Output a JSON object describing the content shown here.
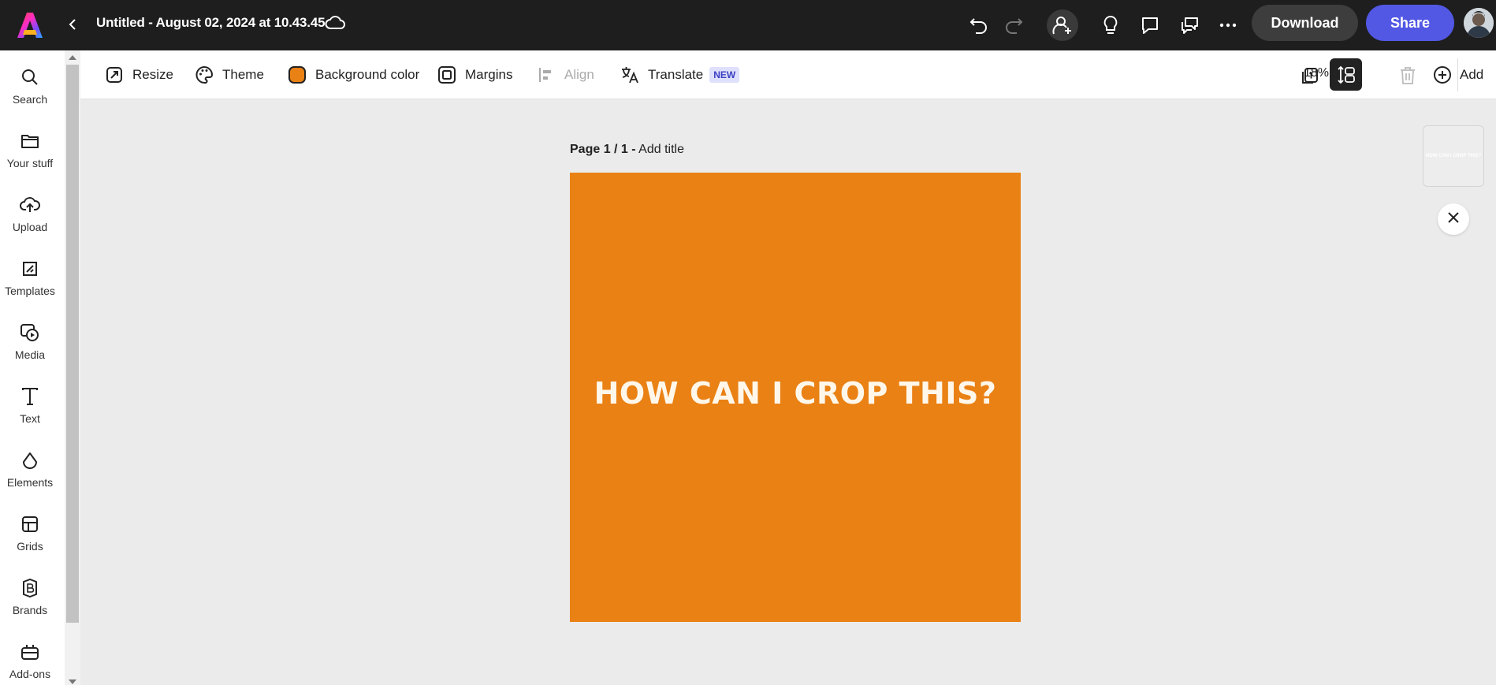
{
  "header": {
    "title": "Untitled - August 02, 2024 at 10.43.45",
    "download_label": "Download",
    "share_label": "Share",
    "icons": [
      "adobe-express-logo",
      "back-chevron-icon",
      "cloud-icon",
      "undo-icon",
      "redo-icon",
      "invite-user-icon",
      "lightbulb-icon",
      "comment-icon",
      "chat-icon",
      "more-icon",
      "avatar"
    ]
  },
  "sidebar": {
    "items": [
      {
        "label": "Search",
        "icon": "search-icon"
      },
      {
        "label": "Your stuff",
        "icon": "folder-icon"
      },
      {
        "label": "Upload",
        "icon": "upload-icon"
      },
      {
        "label": "Templates",
        "icon": "templates-icon"
      },
      {
        "label": "Media",
        "icon": "media-icon"
      },
      {
        "label": "Text",
        "icon": "text-icon"
      },
      {
        "label": "Elements",
        "icon": "elements-icon"
      },
      {
        "label": "Grids",
        "icon": "grids-icon"
      },
      {
        "label": "Brands",
        "icon": "brands-icon"
      },
      {
        "label": "Add-ons",
        "icon": "addons-icon"
      }
    ]
  },
  "toolbar": {
    "resize": "Resize",
    "theme": "Theme",
    "background_color": "Background color",
    "margins": "Margins",
    "align": "Align",
    "translate": "Translate",
    "translate_badge": "NEW",
    "zoom": "18%",
    "add": "Add"
  },
  "canvas": {
    "page_number": "Page 1 / 1 -",
    "add_title": "Add title",
    "artboard_text": "HOW CAN I CROP THIS?",
    "background": "#ea8114",
    "thumbnail_text": "HOW CAN I CROP THIS?"
  },
  "colors": {
    "share_button": "#5258e4",
    "topbar": "#1e1e1e",
    "swatch": "#ea8114"
  }
}
